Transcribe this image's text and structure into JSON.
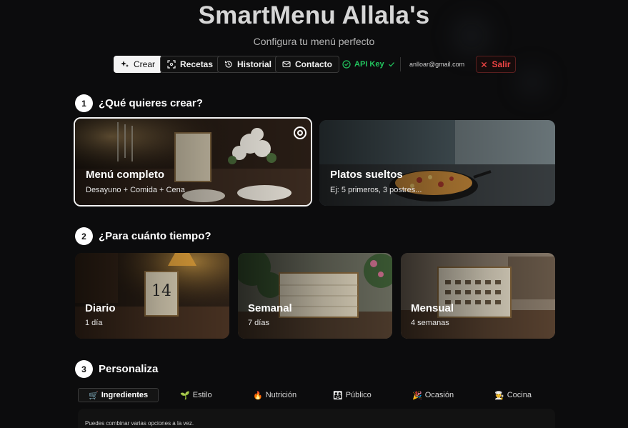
{
  "header": {
    "title": "SmartMenu Allala's",
    "subtitle": "Configura tu menú perfecto"
  },
  "nav": {
    "items": [
      {
        "label": "Crear",
        "icon": "sparkles-icon",
        "active": true
      },
      {
        "label": "Recetas",
        "icon": "scan-icon",
        "active": false
      },
      {
        "label": "Historial",
        "icon": "history-icon",
        "active": false
      },
      {
        "label": "Contacto",
        "icon": "mail-icon",
        "active": false
      }
    ],
    "api_key_label": "API Key",
    "api_key_status": "verified",
    "email": "anlloar@gmail.com",
    "logout_label": "Salir"
  },
  "section1": {
    "number": "1",
    "title": "¿Qué quieres crear?",
    "cards": [
      {
        "title": "Menú completo",
        "subtitle": "Desayuno + Comida + Cena",
        "selected": true
      },
      {
        "title": "Platos sueltos",
        "subtitle": "Ej: 5 primeros, 3 postres...",
        "selected": false
      }
    ]
  },
  "section2": {
    "number": "2",
    "title": "¿Para cuánto tiempo?",
    "cards": [
      {
        "title": "Diario",
        "subtitle": "1 día",
        "image_text": "14"
      },
      {
        "title": "Semanal",
        "subtitle": "7 días"
      },
      {
        "title": "Mensual",
        "subtitle": "4 semanas"
      }
    ]
  },
  "section3": {
    "number": "3",
    "title": "Personaliza",
    "tabs": [
      {
        "label": "Ingredientes",
        "emoji": "🛒",
        "active": true
      },
      {
        "label": "Estilo",
        "emoji": "🌱",
        "active": false
      },
      {
        "label": "Nutrición",
        "emoji": "🔥",
        "active": false
      },
      {
        "label": "Público",
        "emoji": "👨‍👩‍👧",
        "active": false
      },
      {
        "label": "Ocasión",
        "emoji": "🎉",
        "active": false
      },
      {
        "label": "Cocina",
        "emoji": "🧑‍🍳",
        "active": false
      }
    ],
    "hint": "Puedes combinar varias opciones a la vez."
  },
  "colors": {
    "background": "#0c0c0d",
    "accent_green": "#22c55e",
    "danger_red": "#ef4444"
  }
}
